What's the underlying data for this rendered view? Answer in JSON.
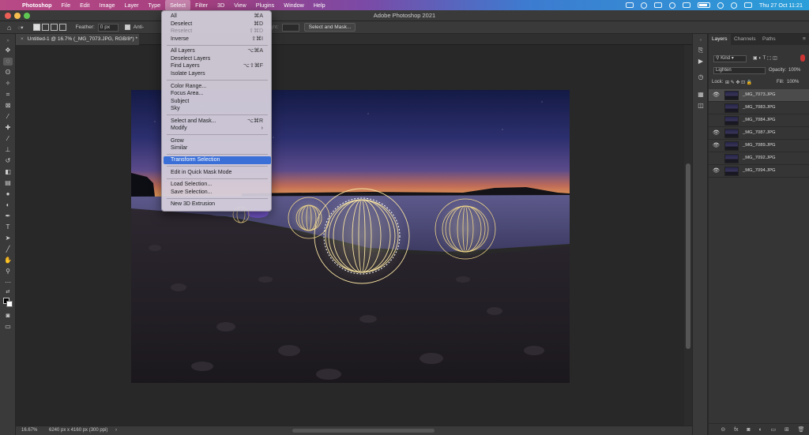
{
  "menubar": {
    "items": [
      "Photoshop",
      "File",
      "Edit",
      "Image",
      "Layer",
      "Type",
      "Select",
      "Filter",
      "3D",
      "View",
      "Plugins",
      "Window",
      "Help"
    ],
    "clock": "Thu 27 Oct  11:21"
  },
  "window": {
    "title": "Adobe Photoshop 2021"
  },
  "options_bar": {
    "feather_label": "Feather:",
    "feather_value": "0 px",
    "antialias_label": "Anti-",
    "height_label": "Height:",
    "select_mask_button": "Select and Mask..."
  },
  "document": {
    "tab_title": "Untitled-1 @ 16.7% (_MG_7073.JPG, RGB/8*) *"
  },
  "status": {
    "zoom": "16.67%",
    "doc_info": "6240 px x 4160 px (300 ppi)",
    "arrow": "›"
  },
  "select_menu": {
    "items": [
      {
        "label": "All",
        "shortcut": "⌘A"
      },
      {
        "label": "Deselect",
        "shortcut": "⌘D"
      },
      {
        "label": "Reselect",
        "shortcut": "⇧⌘D",
        "disabled": true
      },
      {
        "label": "Inverse",
        "shortcut": "⇧⌘I"
      },
      {
        "label": "All Layers",
        "shortcut": "⌥⌘A"
      },
      {
        "label": "Deselect Layers",
        "shortcut": ""
      },
      {
        "label": "Find Layers",
        "shortcut": "⌥⇧⌘F"
      },
      {
        "label": "Isolate Layers",
        "shortcut": ""
      },
      {
        "label": "Color Range...",
        "shortcut": ""
      },
      {
        "label": "Focus Area...",
        "shortcut": ""
      },
      {
        "label": "Subject",
        "shortcut": ""
      },
      {
        "label": "Sky",
        "shortcut": ""
      },
      {
        "label": "Select and Mask...",
        "shortcut": "⌥⌘R"
      },
      {
        "label": "Modify",
        "shortcut": "›"
      },
      {
        "label": "Grow",
        "shortcut": ""
      },
      {
        "label": "Similar",
        "shortcut": ""
      },
      {
        "label": "Transform Selection",
        "shortcut": "",
        "highlighted": true
      },
      {
        "label": "Edit in Quick Mask Mode",
        "shortcut": ""
      },
      {
        "label": "Load Selection...",
        "shortcut": ""
      },
      {
        "label": "Save Selection...",
        "shortcut": ""
      },
      {
        "label": "New 3D Extrusion",
        "shortcut": ""
      }
    ]
  },
  "layers_panel": {
    "tabs": [
      "Layers",
      "Channels",
      "Paths"
    ],
    "filter_kind": "Kind",
    "blend_mode": "Lighten",
    "opacity_label": "Opacity:",
    "opacity_value": "100%",
    "lock_label": "Lock:",
    "fill_label": "Fill:",
    "fill_value": "100%",
    "layers": [
      {
        "name": "_MG_7073.JPG",
        "visible": true,
        "selected": true
      },
      {
        "name": "_MG_7083.JPG",
        "visible": false
      },
      {
        "name": "_MG_7084.JPG",
        "visible": false
      },
      {
        "name": "_MG_7087.JPG",
        "visible": true
      },
      {
        "name": "_MG_7089.JPG",
        "visible": true
      },
      {
        "name": "_MG_7092.JPG",
        "visible": false
      },
      {
        "name": "_MG_7094.JPG",
        "visible": true
      }
    ],
    "footer_icons": [
      "link-icon",
      "fx-icon",
      "mask-icon",
      "adjustment-icon",
      "group-icon",
      "new-layer-icon",
      "trash-icon"
    ]
  },
  "colors": {
    "menu_highlight": "#3a6fd8",
    "ui_dark": "#3a3a3a",
    "canvas_bg": "#282828"
  }
}
